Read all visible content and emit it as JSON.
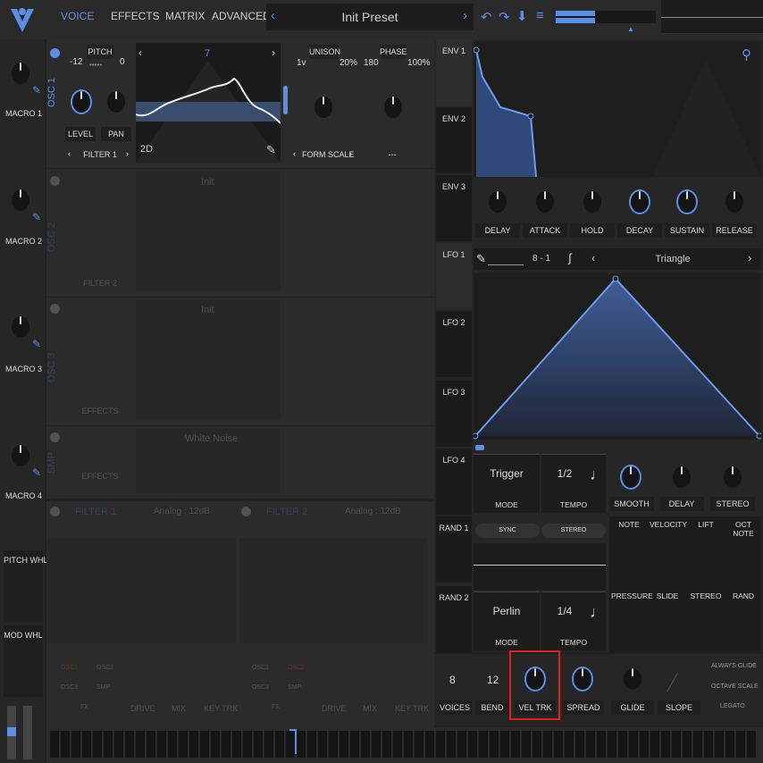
{
  "app": {
    "logo": "V-logo"
  },
  "tabs": [
    "VOICE",
    "EFFECTS",
    "MATRIX",
    "ADVANCED"
  ],
  "preset": {
    "name": "Init Preset"
  },
  "macros": [
    "MACRO 1",
    "MACRO 2",
    "MACRO 3",
    "MACRO 4"
  ],
  "wheels": [
    "PITCH WHL",
    "MOD WHL"
  ],
  "osc1": {
    "side": "OSC 1",
    "pitch_label": "PITCH",
    "pitch_lo": "-12",
    "pitch_hi": "0",
    "wave_index": "7",
    "mode": "2D",
    "level": "LEVEL",
    "pan": "PAN",
    "route": "FILTER 1",
    "unison": "UNISON",
    "phase": "PHASE",
    "u1": "1v",
    "u2": "20%",
    "p1": "180",
    "p2": "100%",
    "form": "FORM SCALE",
    "form_val": "---"
  },
  "osc2": {
    "side": "OSC 2",
    "wave_name": "Init",
    "route": "FILTER 2"
  },
  "osc3": {
    "side": "OSC 3",
    "wave_name": "Init",
    "route": "EFFECTS"
  },
  "smp": {
    "side": "SMP",
    "wave_name": "White Noise",
    "route": "EFFECTS"
  },
  "filters": [
    {
      "name": "FILTER 1",
      "model": "Analog : 12dB"
    },
    {
      "name": "FILTER 2",
      "model": "Analog : 12dB"
    }
  ],
  "filter_knobs": [
    "DRIVE",
    "MIX",
    "KEY TRK"
  ],
  "filter_src": [
    "OSC1",
    "OSC2",
    "OSC3",
    "SMP",
    "FX"
  ],
  "mod_slots": {
    "env": [
      "ENV 1",
      "ENV 2",
      "ENV 3"
    ],
    "lfo": [
      "LFO 1",
      "LFO 2",
      "LFO 3",
      "LFO 4"
    ],
    "rand": [
      "RAND 1",
      "RAND 2"
    ]
  },
  "env_params": [
    "DELAY",
    "ATTACK",
    "HOLD",
    "DECAY",
    "SUSTAIN",
    "RELEASE"
  ],
  "lfo": {
    "shape": "Triangle",
    "sync": "8 - 1",
    "mode_value": "Trigger",
    "mode_label": "MODE",
    "tempo_value": "1/2",
    "tempo_label": "TEMPO",
    "knobs": [
      "SMOOTH",
      "DELAY",
      "STEREO"
    ]
  },
  "rand": {
    "sync": "SYNC",
    "stereo": "STEREO",
    "mode_value": "Perlin",
    "mode_label": "MODE",
    "tempo_value": "1/4",
    "tempo_label": "TEMPO"
  },
  "mod_sources_top": [
    "NOTE",
    "VELOCITY",
    "LIFT",
    "OCT NOTE"
  ],
  "mod_sources_bottom": [
    "PRESSURE",
    "SLIDE",
    "STEREO",
    "RAND"
  ],
  "voice": {
    "voices_value": "8",
    "voices": "VOICES",
    "bend_value": "12",
    "bend": "BEND",
    "veltrk": "VEL TRK",
    "spread": "SPREAD",
    "glide": "GLIDE",
    "slope": "SLOPE",
    "opts": [
      "ALWAYS GLIDE",
      "OCTAVE SCALE",
      "LEGATO"
    ]
  },
  "colors": {
    "accent": "#5b8fe6",
    "highlight": "#e02020"
  }
}
